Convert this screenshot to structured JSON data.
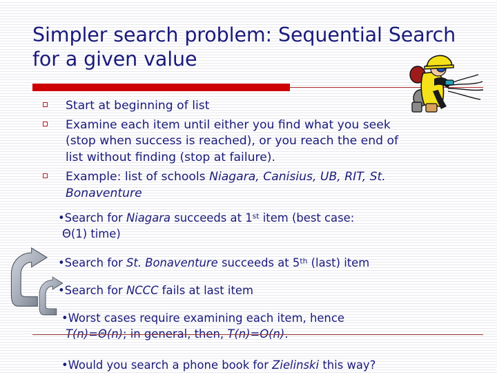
{
  "slide": {
    "title": "Simpler search problem: Sequential Search for a given value",
    "title_color": "#1a1a7a",
    "accent_bar_color": "#cc0000",
    "divider_color": "#9c3a3a",
    "bullet_marker_color": "#b02020",
    "background_color": "#ffffff",
    "stripe_color": "#e8e8ee"
  },
  "bullets": {
    "b1": "Start at beginning of list",
    "b2_line1": "Examine each item until either you find what you seek",
    "b2_line2": "(stop when success is reached), or you reach the end of",
    "b2_line3": "list without finding (stop at failure).",
    "b3_prefix": "Example:  list of schools ",
    "b3_italic_line1": "Niagara, Canisius, UB, RIT, St.",
    "b3_italic_line2": "Bonaventure"
  },
  "subbullets": {
    "s1_dot": "•",
    "s1_a": "Search for ",
    "s1_italic": "Niagara",
    "s1_b": " succeeds at 1",
    "s1_sup": "st",
    "s1_c": " item (best case:",
    "s1_line2": "Θ(1) time)",
    "s2_dot": "•",
    "s2_a": "Search for ",
    "s2_italic": "St. Bonaventure",
    "s2_b": " succeeds at 5",
    "s2_sup": "th",
    "s2_c": " (last) item",
    "s3_dot": "•",
    "s3_a": "Search for ",
    "s3_italic": "NCCC",
    "s3_b": " fails at last item",
    "s4_dot": "•",
    "s4_a": "Worst cases require examining each item, hence",
    "s4_italic_line2a": "T(n)=Θ(n)",
    "s4_line2b": "; in general, then, ",
    "s4_italic_line2c": "T(n)=O(n)",
    "s4_line2d": ".",
    "s5_dot": "•",
    "s5_a": "Would you search a phone book for ",
    "s5_italic": "Zielinski",
    "s5_b": " this way?"
  },
  "graphics": {
    "firefighter_alt": "firefighter-clipart",
    "arrows_alt": "curved-arrows-clipart"
  }
}
